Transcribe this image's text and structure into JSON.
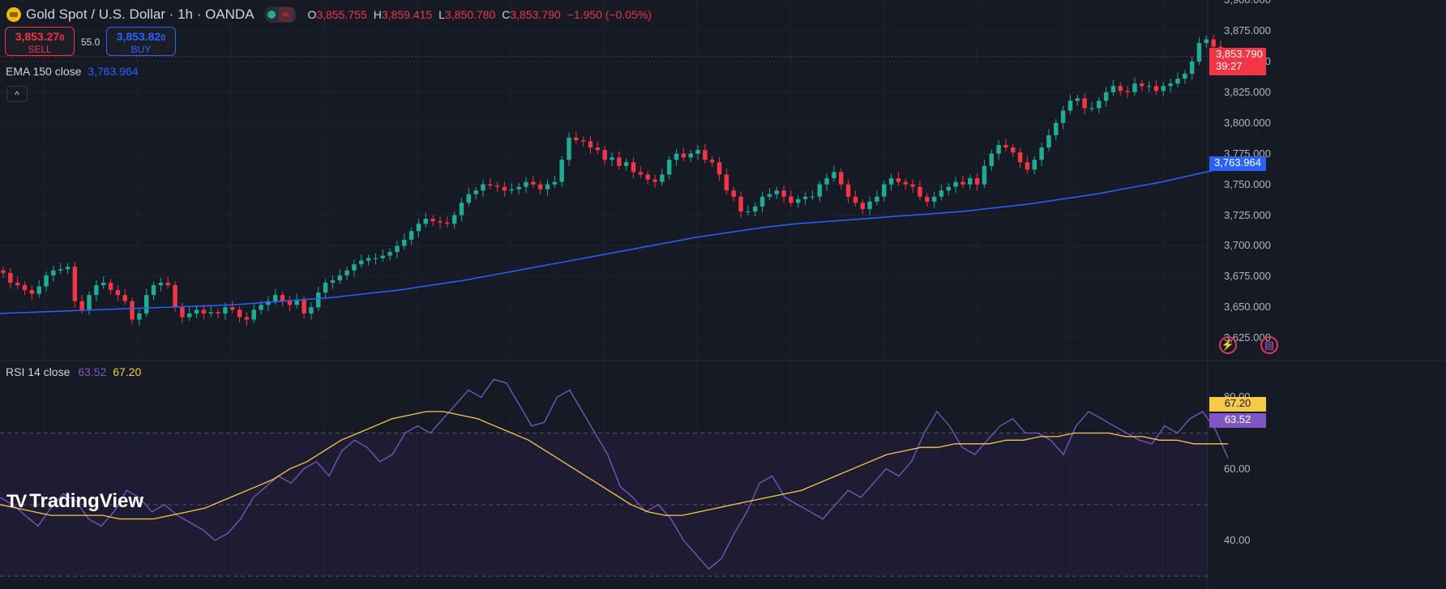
{
  "header": {
    "title": "Gold Spot / U.S. Dollar · 1h · OANDA",
    "ohlc": [
      {
        "k": "O",
        "v": "3,855.755"
      },
      {
        "k": "H",
        "v": "3,859.415"
      },
      {
        "k": "L",
        "v": "3,850.780"
      },
      {
        "k": "C",
        "v": "3,853.790"
      },
      {
        "k": "",
        "v": "−1.950 (−0.05%)"
      }
    ]
  },
  "trade": {
    "sell_price": "3,853.27",
    "sell_price_small": "0",
    "sell_label": "SELL",
    "spread": "55.0",
    "buy_price": "3,853.82",
    "buy_price_small": "0",
    "buy_label": "BUY"
  },
  "ema": {
    "label": "EMA 150 close",
    "value": "3,763.964"
  },
  "rsi": {
    "label": "RSI 14 close",
    "value": "63.52",
    "ma_value": "67.20"
  },
  "price_axis": {
    "ticks": [
      "3,900.000",
      "3,875.000",
      "3,850.000",
      "3,825.000",
      "3,800.000",
      "3,775.000",
      "3,750.000",
      "3,725.000",
      "3,700.000",
      "3,675.000",
      "3,650.000",
      "3,625.000"
    ],
    "last_price_label": "3,853.790",
    "countdown": "39:27",
    "ema_label": "3,763.964"
  },
  "rsi_axis": {
    "ticks": [
      "80.00",
      "60.00",
      "40.00"
    ],
    "ma_label": "67.20",
    "rsi_label": "63.52"
  },
  "brand": {
    "name": "TradingView"
  },
  "colors": {
    "up": "#22ab94",
    "down": "#f23645",
    "ema": "#2962ff",
    "rsi": "#7e57c2",
    "rsi_ma": "#f7c948",
    "bg": "#161a25"
  },
  "chart_data": [
    {
      "type": "candlestick",
      "ylim": [
        3610,
        3900
      ],
      "open": [
        3680,
        3678,
        3670,
        3668,
        3664,
        3661,
        3667,
        3676,
        3680,
        3681,
        3683,
        3655,
        3648,
        3660,
        3668,
        3670,
        3664,
        3660,
        3655,
        3640,
        3645,
        3660,
        3668,
        3670,
        3668,
        3650,
        3642,
        3645,
        3648,
        3645,
        3646,
        3645,
        3650,
        3648,
        3642,
        3640,
        3648,
        3652,
        3655,
        3660,
        3655,
        3652,
        3656,
        3645,
        3650,
        3662,
        3670,
        3672,
        3676,
        3680,
        3685,
        3688,
        3690,
        3690,
        3692,
        3695,
        3700,
        3705,
        3712,
        3718,
        3722,
        3720,
        3719,
        3718,
        3725,
        3735,
        3742,
        3745,
        3750,
        3749,
        3748,
        3745,
        3746,
        3748,
        3752,
        3750,
        3746,
        3750,
        3752,
        3770,
        3788,
        3786,
        3785,
        3780,
        3778,
        3770,
        3772,
        3765,
        3768,
        3760,
        3758,
        3754,
        3752,
        3758,
        3770,
        3775,
        3772,
        3775,
        3778,
        3770,
        3768,
        3758,
        3745,
        3740,
        3728,
        3728,
        3732,
        3740,
        3742,
        3745,
        3740,
        3735,
        3738,
        3740,
        3740,
        3750,
        3755,
        3760,
        3750,
        3740,
        3735,
        3730,
        3736,
        3740,
        3750,
        3755,
        3752,
        3750,
        3748,
        3740,
        3736,
        3740,
        3745,
        3748,
        3752,
        3750,
        3755,
        3750,
        3765,
        3775,
        3782,
        3780,
        3776,
        3768,
        3762,
        3770,
        3780,
        3790,
        3800,
        3810,
        3818,
        3820,
        3812,
        3812,
        3818,
        3825,
        3830,
        3826,
        3825,
        3832,
        3830,
        3830,
        3826,
        3830,
        3832,
        3836,
        3840,
        3850,
        3865,
        3868,
        3862
      ],
      "close": [
        3678,
        3670,
        3668,
        3664,
        3661,
        3667,
        3676,
        3680,
        3681,
        3683,
        3655,
        3648,
        3660,
        3668,
        3670,
        3664,
        3660,
        3655,
        3640,
        3645,
        3660,
        3668,
        3670,
        3668,
        3650,
        3642,
        3645,
        3648,
        3645,
        3646,
        3645,
        3650,
        3648,
        3642,
        3640,
        3648,
        3652,
        3655,
        3660,
        3655,
        3652,
        3656,
        3645,
        3650,
        3662,
        3670,
        3672,
        3676,
        3680,
        3685,
        3688,
        3690,
        3690,
        3692,
        3695,
        3700,
        3705,
        3712,
        3718,
        3722,
        3720,
        3719,
        3718,
        3725,
        3735,
        3742,
        3745,
        3750,
        3749,
        3748,
        3745,
        3746,
        3748,
        3752,
        3750,
        3746,
        3750,
        3752,
        3770,
        3788,
        3786,
        3785,
        3780,
        3778,
        3770,
        3772,
        3765,
        3768,
        3760,
        3758,
        3754,
        3752,
        3758,
        3770,
        3775,
        3772,
        3775,
        3778,
        3770,
        3768,
        3758,
        3745,
        3740,
        3728,
        3728,
        3732,
        3740,
        3742,
        3745,
        3740,
        3735,
        3738,
        3740,
        3740,
        3750,
        3755,
        3760,
        3750,
        3740,
        3735,
        3730,
        3736,
        3740,
        3750,
        3755,
        3752,
        3750,
        3748,
        3740,
        3736,
        3740,
        3745,
        3748,
        3752,
        3750,
        3755,
        3750,
        3765,
        3775,
        3782,
        3780,
        3776,
        3768,
        3762,
        3770,
        3780,
        3790,
        3800,
        3810,
        3818,
        3820,
        3812,
        3812,
        3818,
        3825,
        3830,
        3826,
        3825,
        3832,
        3830,
        3830,
        3826,
        3830,
        3832,
        3836,
        3840,
        3850,
        3865,
        3868,
        3862,
        3854
      ],
      "ema150": [
        3645,
        3646,
        3647,
        3648,
        3649,
        3650,
        3651,
        3652,
        3654,
        3656,
        3658,
        3661,
        3664,
        3668,
        3672,
        3677,
        3682,
        3687,
        3692,
        3697,
        3702,
        3707,
        3711,
        3715,
        3718,
        3720,
        3722,
        3724,
        3726,
        3728,
        3731,
        3734,
        3738,
        3742,
        3747,
        3752,
        3758,
        3764
      ]
    },
    {
      "type": "line",
      "title": "RSI 14 close",
      "ylim": [
        28,
        88
      ],
      "series": [
        {
          "name": "RSI",
          "values": [
            52,
            50,
            47,
            44,
            49,
            53,
            51,
            46,
            44,
            48,
            54,
            52,
            48,
            50,
            47,
            45,
            43,
            40,
            42,
            46,
            52,
            55,
            58,
            56,
            60,
            62,
            58,
            65,
            68,
            66,
            62,
            64,
            70,
            72,
            70,
            74,
            78,
            82,
            80,
            85,
            84,
            78,
            72,
            73,
            80,
            82,
            76,
            70,
            64,
            55,
            52,
            48,
            50,
            46,
            40,
            36,
            32,
            35,
            42,
            48,
            56,
            58,
            52,
            50,
            48,
            46,
            50,
            54,
            52,
            56,
            60,
            58,
            62,
            70,
            76,
            72,
            66,
            64,
            68,
            72,
            74,
            70,
            70,
            68,
            64,
            72,
            76,
            74,
            72,
            70,
            68,
            67,
            72,
            70,
            74,
            76,
            71,
            63
          ]
        },
        {
          "name": "MA",
          "values": [
            50,
            49,
            48,
            47,
            47,
            47,
            47,
            46,
            46,
            46,
            47,
            48,
            49,
            51,
            53,
            55,
            57,
            60,
            62,
            65,
            68,
            70,
            72,
            74,
            75,
            76,
            76,
            75,
            74,
            72,
            70,
            68,
            65,
            62,
            59,
            56,
            53,
            50,
            48,
            47,
            47,
            48,
            49,
            50,
            51,
            52,
            53,
            54,
            56,
            58,
            60,
            62,
            64,
            65,
            66,
            66,
            67,
            67,
            67,
            68,
            68,
            69,
            69,
            70,
            70,
            70,
            69,
            69,
            68,
            68,
            67,
            67,
            67
          ]
        }
      ]
    }
  ]
}
